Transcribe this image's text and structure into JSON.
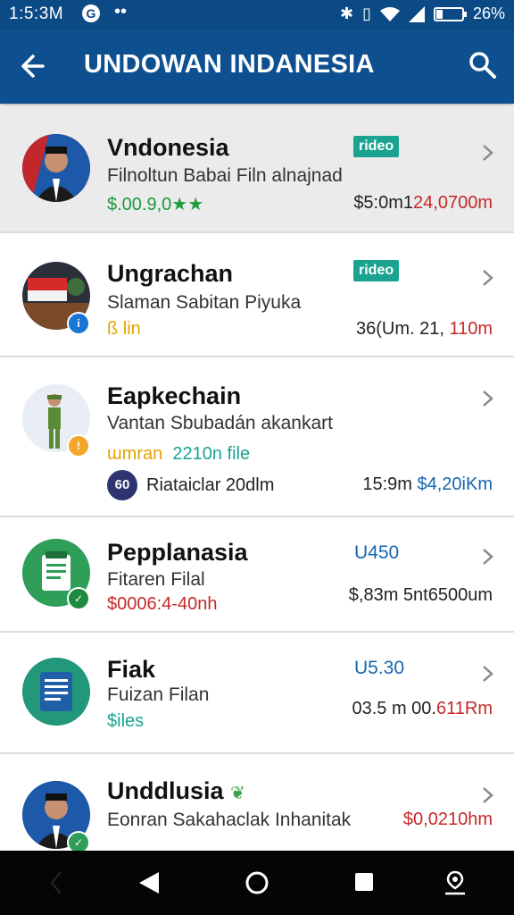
{
  "status_bar": {
    "time": "1:5:3M",
    "battery": "26%",
    "battery_level": 0.26
  },
  "app_bar": {
    "title": "UNDOWAN INDANESIA",
    "back_icon": "arrow-left-icon",
    "search_icon": "search-icon"
  },
  "items": [
    {
      "name": "Vndonesia",
      "subtitle": "Filnoltun Babai Filn alnajnad",
      "meta": "$.00.9,0",
      "meta_stars": "★★",
      "tag": "ridеo",
      "amount_a": "$5:0m1",
      "amount_b": "24,0700m",
      "colors": {
        "meta": "#1e9a3c",
        "amount_b": "#c62828"
      }
    },
    {
      "name": "Ungrachan",
      "subtitle": "Slaman Sabitan Piyuka",
      "meta": "ß lin",
      "tag": "ridеo",
      "amount_a": "36(Um. 21, ",
      "amount_b": "110m",
      "colors": {
        "meta": "#e0a400",
        "amount_b": "#c62828"
      }
    },
    {
      "name": "Eapkechain",
      "subtitle": "Vantan Sbubadán akankart",
      "meta_a": "ɯmran",
      "meta_b": "2210n file",
      "owner_initials": "60",
      "owner": "Riataiclar 20dlm",
      "amount_a": "15:9m ",
      "amount_b": "$4,20iKm",
      "colors": {
        "meta_a": "#e0a400",
        "meta_b": "#1aa390",
        "amount_b": "#1566b0"
      }
    },
    {
      "name": "Pepplanasia",
      "subtitle": "Fitaren Filal",
      "meta": "$0006:4-40nh",
      "price": "U450",
      "amount_a": "$,83m 5nt6500um",
      "colors": {
        "meta": "#c62828"
      }
    },
    {
      "name": "Fiak",
      "subtitle": "Fuizan Filan",
      "meta": "$iles",
      "price": "U5.30",
      "amount_a": "03.5 m 00.",
      "amount_b": "611Rm",
      "colors": {
        "meta": "#1aa390",
        "amount_b": "#c62828"
      }
    },
    {
      "name": "Unddlusia",
      "subtitle": "Eonran Sakahaclak Inhanitak",
      "amount_b": "$0,0210hm",
      "colors": {
        "amount_b": "#c62828"
      }
    }
  ]
}
